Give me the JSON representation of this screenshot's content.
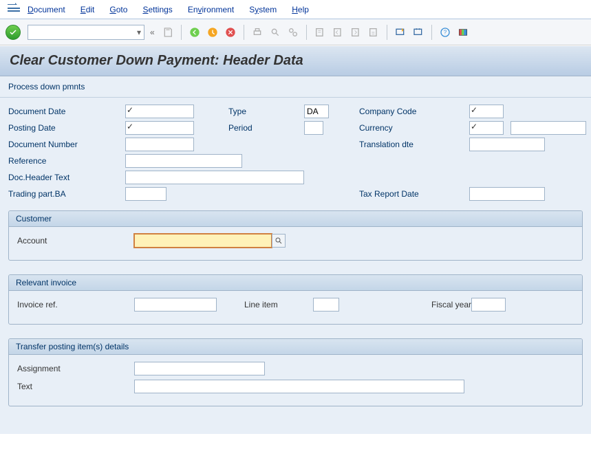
{
  "menu": {
    "document": "Document",
    "edit": "Edit",
    "goto": "Goto",
    "settings": "Settings",
    "environment": "Environment",
    "system": "System",
    "help": "Help"
  },
  "title": "Clear Customer Down Payment: Header Data",
  "subtoolbar": {
    "process": "Process down pmnts"
  },
  "header": {
    "doc_date_lbl": "Document Date",
    "type_lbl": "Type",
    "type_val": "DA",
    "cocode_lbl": "Company Code",
    "post_date_lbl": "Posting Date",
    "period_lbl": "Period",
    "currency_lbl": "Currency",
    "docnum_lbl": "Document Number",
    "transdte_lbl": "Translation dte",
    "ref_lbl": "Reference",
    "dochdr_lbl": "Doc.Header Text",
    "tradeba_lbl": "Trading part.BA",
    "taxrep_lbl": "Tax Report Date"
  },
  "groups": {
    "customer_title": "Customer",
    "account_lbl": "Account",
    "relevant_title": "Relevant invoice",
    "invref_lbl": "Invoice ref.",
    "lineitem_lbl": "Line item",
    "fiscal_lbl": "Fiscal year",
    "transfer_title": "Transfer posting item(s) details",
    "assign_lbl": "Assignment",
    "text_lbl": "Text"
  }
}
